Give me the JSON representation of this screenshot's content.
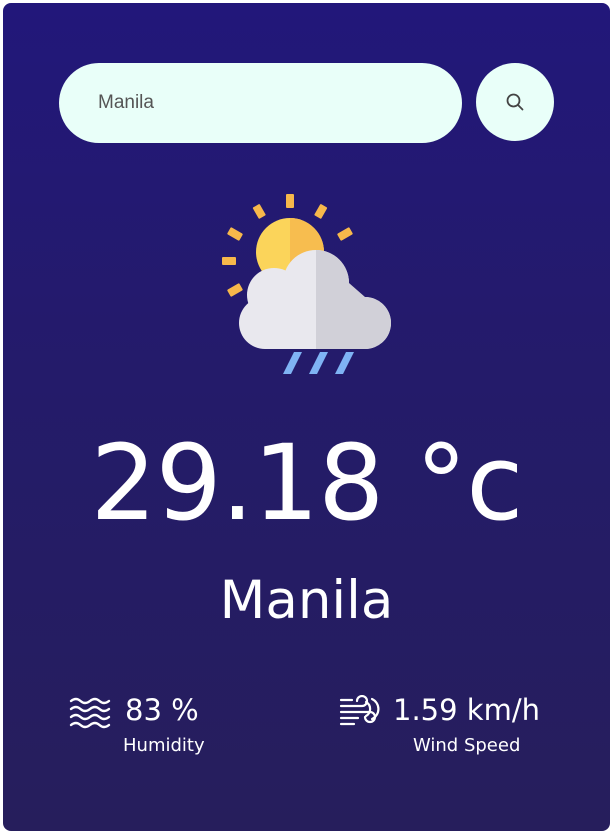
{
  "search": {
    "value": "Manila",
    "button_icon": "search-icon"
  },
  "weather": {
    "icon": "sun-behind-rain-cloud-icon",
    "temperature": "29.18 °c",
    "city": "Manila"
  },
  "details": {
    "humidity": {
      "icon": "humidity-waves-icon",
      "value": "83 %",
      "label": "Humidity"
    },
    "wind": {
      "icon": "wind-icon",
      "value": "1.59 km/h",
      "label": "Wind Speed"
    }
  },
  "colors": {
    "card_top": "#22177a",
    "card_bottom": "#261e5c",
    "input_background": "#e9fff9",
    "text": "#ffffff",
    "sun": "#fbd45a",
    "cloud": "#e9e8ee",
    "rain": "#7fb3f4"
  }
}
